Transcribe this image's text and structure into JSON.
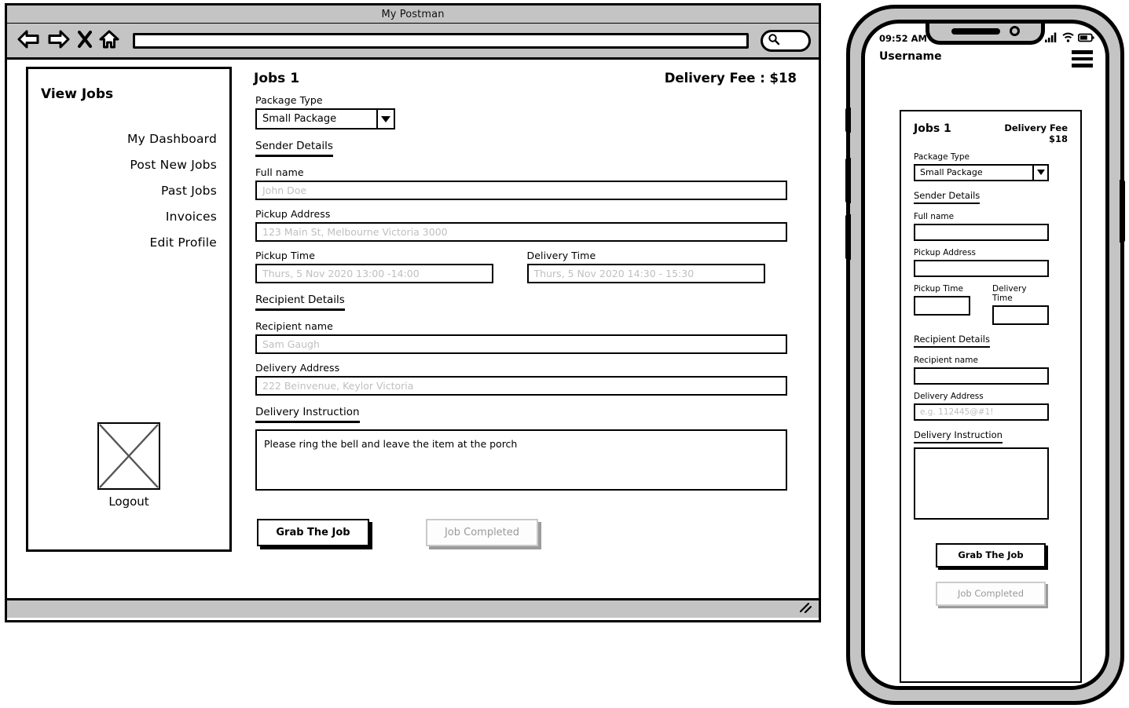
{
  "browser": {
    "title": "My Postman",
    "toolbar": {
      "back_icon": "back-arrow-icon",
      "forward_icon": "forward-arrow-icon",
      "stop_icon": "close-x-icon",
      "home_icon": "home-icon",
      "url_value": "",
      "url_placeholder": "",
      "search_icon": "search-icon"
    },
    "statusbar": {
      "resize_icon": "resize-grip-icon"
    }
  },
  "sidebar": {
    "title": "View Jobs",
    "items": [
      {
        "label": "My Dashboard"
      },
      {
        "label": "Post New Jobs"
      },
      {
        "label": "Past Jobs"
      },
      {
        "label": "Invoices"
      },
      {
        "label": "Edit Profile"
      }
    ],
    "logout": {
      "image_placeholder_icon": "image-placeholder-icon",
      "label": "Logout"
    }
  },
  "desktop_form": {
    "jobs_title": "Jobs 1",
    "delivery_fee": "Delivery Fee : $18",
    "package_type_label": "Package Type",
    "package_type_value": "Small Package",
    "package_type_options": [
      "Small Package"
    ],
    "dropdown_icon": "chevron-down-icon",
    "sender_section": "Sender Details",
    "full_name_label": "Full name",
    "full_name_placeholder": "John Doe",
    "full_name_value": "",
    "pickup_address_label": "Pickup Address",
    "pickup_address_placeholder": "123 Main St, Melbourne Victoria 3000",
    "pickup_address_value": "",
    "pickup_time_label": "Pickup Time",
    "pickup_time_placeholder": "Thurs, 5 Nov 2020 13:00 -14:00",
    "pickup_time_value": "",
    "delivery_time_label": "Delivery Time",
    "delivery_time_placeholder": "Thurs, 5 Nov 2020 14:30 - 15:30",
    "delivery_time_value": "",
    "recipient_section": "Recipient Details",
    "recipient_name_label": "Recipient name",
    "recipient_name_placeholder": "Sam Gaugh",
    "recipient_name_value": "",
    "delivery_address_label": "Delivery Address",
    "delivery_address_placeholder": "222 Beinvenue, Keylor Victoria",
    "delivery_address_value": "",
    "delivery_instruction_section": "Delivery Instruction",
    "delivery_instruction_value": "Please ring the bell and leave the item at the porch",
    "grab_button": "Grab The Job",
    "completed_button": "Job Completed"
  },
  "phone": {
    "statusbar": {
      "time": "09:52 AM",
      "signal_icon": "cellular-signal-icon",
      "wifi_icon": "wifi-icon",
      "battery_icon": "battery-icon"
    },
    "username": "Username",
    "menu_icon": "hamburger-menu-icon",
    "form": {
      "jobs_title": "Jobs 1",
      "delivery_fee_line1": "Delivery Fee",
      "delivery_fee_line2": "$18",
      "package_type_label": "Package Type",
      "package_type_value": "Small Package",
      "dropdown_icon": "chevron-down-icon",
      "sender_section": "Sender Details",
      "full_name_label": "Full name",
      "full_name_value": "",
      "pickup_address_label": "Pickup Address",
      "pickup_address_value": "",
      "pickup_time_label": "Pickup Time",
      "pickup_time_value": "",
      "delivery_time_label": "Delivery Time",
      "delivery_time_value": "",
      "recipient_section": "Recipient Details",
      "recipient_name_label": "Recipient name",
      "recipient_name_value": "",
      "delivery_address_label": "Delivery Address",
      "delivery_address_placeholder": "e.g. 112445@#1!",
      "delivery_address_value": "",
      "delivery_instruction_section": "Delivery Instruction",
      "delivery_instruction_value": "",
      "grab_button": "Grab The Job",
      "completed_button": "Job Completed"
    }
  },
  "colors": {
    "chrome_gray": "#c4c4c4",
    "ink": "#000000",
    "placeholder": "#bfbfbf",
    "disabled_text": "#9a9a9a",
    "disabled_shadow": "#9b9b9b"
  }
}
